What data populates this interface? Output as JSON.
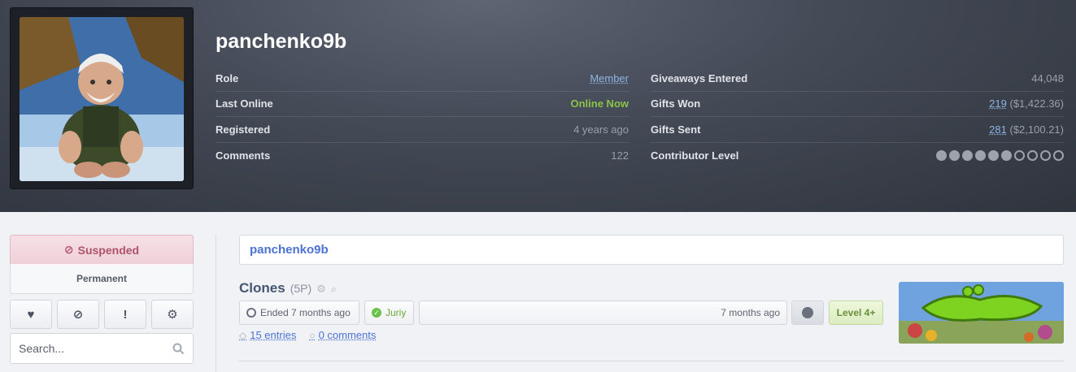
{
  "profile": {
    "username": "panchenko9b",
    "left_stats": [
      {
        "label": "Role",
        "value": "Member",
        "style": "link"
      },
      {
        "label": "Last Online",
        "value": "Online Now",
        "style": "online"
      },
      {
        "label": "Registered",
        "value": "4 years ago",
        "style": "plain"
      },
      {
        "label": "Comments",
        "value": "122",
        "style": "plain"
      }
    ],
    "right_stats": {
      "giveaways_entered_label": "Giveaways Entered",
      "giveaways_entered_value": "44,048",
      "gifts_won_label": "Gifts Won",
      "gifts_won_count": "219",
      "gifts_won_value": "($1,422.36)",
      "gifts_sent_label": "Gifts Sent",
      "gifts_sent_count": "281",
      "gifts_sent_value": "($2,100.21)",
      "contributor_level_label": "Contributor Level",
      "contributor_level_filled": 6,
      "contributor_level_total": 10
    }
  },
  "sidebar": {
    "suspended_label": "Suspended",
    "permanent_label": "Permanent",
    "actions": [
      {
        "icon": "heart-icon",
        "glyph": "♥"
      },
      {
        "icon": "block-icon",
        "glyph": "⊘"
      },
      {
        "icon": "report-icon",
        "glyph": "!"
      },
      {
        "icon": "steam-icon",
        "glyph": "⚙"
      }
    ],
    "search_placeholder": "Search..."
  },
  "main": {
    "heading": "panchenko9b",
    "giveaway": {
      "title": "Clones",
      "points": "(5P)",
      "ended_label": "Ended 7 months ago",
      "creator": "Juriy",
      "time_ago": "7 months ago",
      "level": "Level 4+",
      "entries": "15 entries",
      "comments": "0 comments"
    }
  },
  "colors": {
    "accent": "#4b72d4",
    "online": "#8bc34a",
    "suspended": "#b0526a"
  }
}
